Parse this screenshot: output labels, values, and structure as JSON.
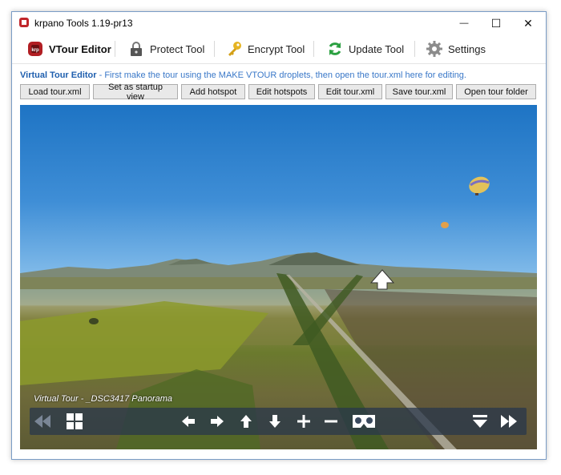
{
  "window": {
    "title": "krpano Tools 1.19-pr13",
    "controls": {
      "minimize": "—",
      "maximize": "☐",
      "close": "✕"
    }
  },
  "toolbar": {
    "items": [
      {
        "label": "VTour Editor",
        "icon": "vtour-editor-icon",
        "active": true
      },
      {
        "label": "Protect Tool",
        "icon": "lock-icon",
        "active": false
      },
      {
        "label": "Encrypt Tool",
        "icon": "key-icon",
        "active": false
      },
      {
        "label": "Update Tool",
        "icon": "refresh-icon",
        "active": false
      },
      {
        "label": "Settings",
        "icon": "gear-icon",
        "active": false
      }
    ]
  },
  "editor": {
    "heading": "Virtual Tour Editor",
    "description": " - First make the tour using the MAKE VTOUR droplets, then open the tour.xml here for editing.",
    "buttons": [
      "Load tour.xml",
      "Set as startup view",
      "Add hotspot",
      "Edit hotspots",
      "Edit tour.xml",
      "Save tour.xml",
      "Open tour folder"
    ]
  },
  "viewer": {
    "caption": "Virtual Tour - _DSC3417 Panorama",
    "controls": [
      "previous-scene-icon",
      "thumbnails-icon",
      "arrow-left-icon",
      "arrow-right-icon",
      "arrow-up-icon",
      "arrow-down-icon",
      "zoom-in-icon",
      "zoom-out-icon",
      "vr-goggles-icon",
      "hide-controls-icon",
      "next-scene-icon"
    ]
  },
  "colors": {
    "accent": "#3a78c8",
    "sky_top": "#1e74c4",
    "control_bar": "#28374b"
  }
}
